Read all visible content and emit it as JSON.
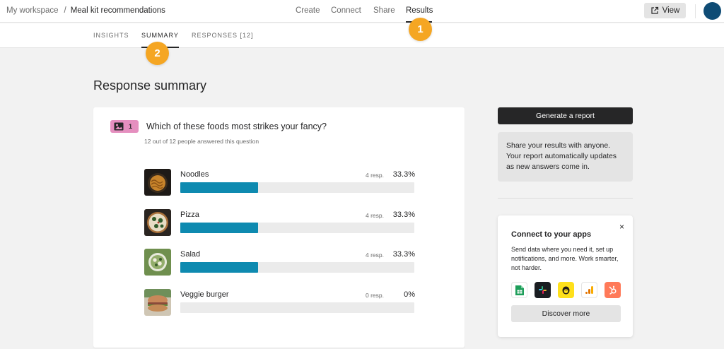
{
  "breadcrumb": {
    "workspace": "My workspace",
    "separator": "/",
    "form_title": "Meal kit recommendations"
  },
  "nav": {
    "create": "Create",
    "connect": "Connect",
    "share": "Share",
    "results": "Results"
  },
  "view_button": {
    "label": "View",
    "icon": "external-link-icon"
  },
  "subtabs": {
    "insights": "INSIGHTS",
    "summary": "SUMMARY",
    "responses": "RESPONSES [12]"
  },
  "callouts": {
    "one": "1",
    "two": "2"
  },
  "page_title": "Response summary",
  "question": {
    "number": "1",
    "icon": "picture-choice-icon",
    "text": "Which of these foods most strikes your fancy?",
    "answered": "12 out of 12 people answered this question",
    "options": [
      {
        "label": "Noodles",
        "resp": "4 resp.",
        "pct": "33.3%",
        "fraction": 0.333
      },
      {
        "label": "Pizza",
        "resp": "4 resp.",
        "pct": "33.3%",
        "fraction": 0.333
      },
      {
        "label": "Salad",
        "resp": "4 resp.",
        "pct": "33.3%",
        "fraction": 0.333
      },
      {
        "label": "Veggie burger",
        "resp": "0 resp.",
        "pct": "0%",
        "fraction": 0
      }
    ]
  },
  "report": {
    "generate_label": "Generate a report",
    "share_text": "Share your results with anyone. Your report automatically updates as new answers come in."
  },
  "apps": {
    "close": "×",
    "title": "Connect to your apps",
    "description": "Send data where you need it, set up notifications, and more. Work smarter, not harder.",
    "icons": [
      "google-sheets-icon",
      "slack-icon",
      "mailchimp-icon",
      "google-analytics-icon",
      "hubspot-icon"
    ],
    "discover_label": "Discover more"
  },
  "colors": {
    "bar": "#0e8ab0",
    "callout": "#f5a623",
    "badge": "#e58fbf",
    "avatar": "#0f4c75"
  }
}
